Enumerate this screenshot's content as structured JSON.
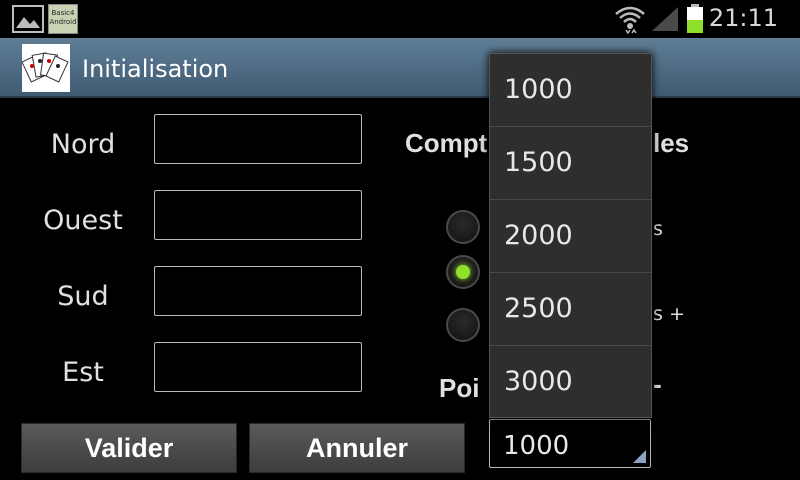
{
  "status_bar": {
    "time": "21:11",
    "notification_badge": "Basic4 Android"
  },
  "title_bar": {
    "title": "Initialisation"
  },
  "players": [
    {
      "label": "Nord",
      "value": ""
    },
    {
      "label": "Ouest",
      "value": ""
    },
    {
      "label": "Sud",
      "value": ""
    },
    {
      "label": "Est",
      "value": ""
    }
  ],
  "scoring": {
    "title_visible_left": "Compt",
    "title_visible_right": "les",
    "options": [
      {
        "visible_text": "s",
        "selected": false
      },
      {
        "visible_text": "",
        "selected": true
      },
      {
        "visible_text": "s +",
        "selected": false
      }
    ],
    "points_label_visible": "Poi",
    "points_label_tail": "-"
  },
  "buttons": {
    "validate": "Valider",
    "cancel": "Annuler"
  },
  "spinner": {
    "selected": "1000",
    "options": [
      "1000",
      "1500",
      "2000",
      "2500",
      "3000"
    ]
  },
  "colors": {
    "radio_selected": "#8ee02a",
    "titlebar": "#4f6b82"
  }
}
